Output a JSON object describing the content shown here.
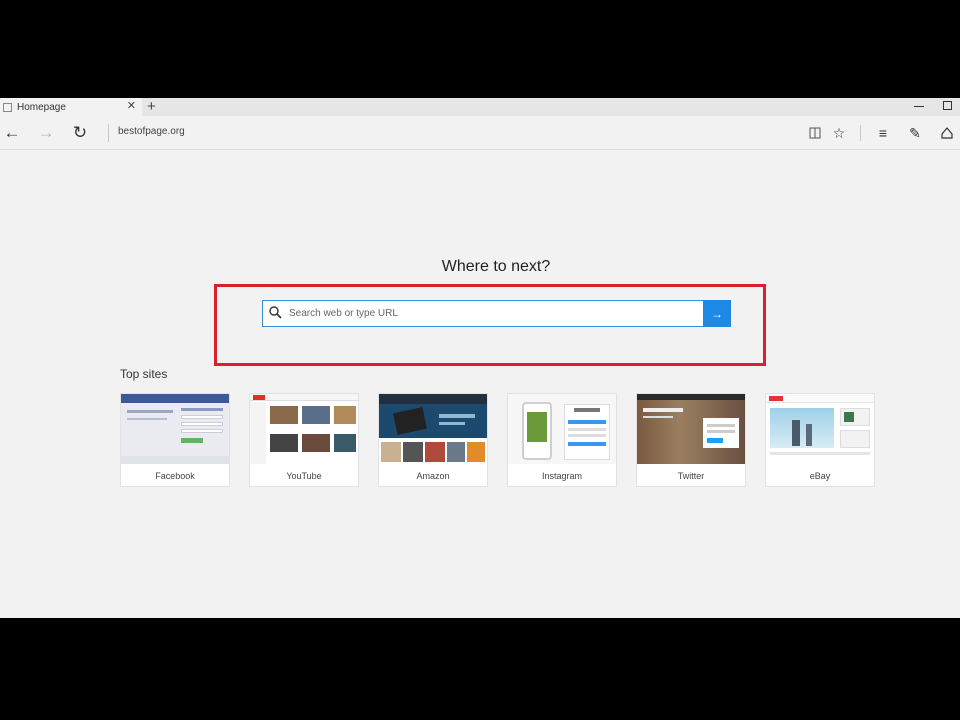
{
  "tab": {
    "title": "Homepage",
    "close": "✕",
    "new_tab": "+"
  },
  "nav": {
    "back_glyph": "←",
    "forward_glyph": "→",
    "refresh_glyph": "↻",
    "address": "bestofpage.org"
  },
  "toolbar": {
    "reading_view": "📖",
    "favorite": "☆",
    "hub": "≡",
    "notes": "✎",
    "share": "⇪"
  },
  "page": {
    "heading": "Where to next?",
    "search_placeholder": "Search web or type URL",
    "search_go": "→",
    "top_sites_label": "Top sites",
    "top_sites": [
      {
        "label": "Facebook"
      },
      {
        "label": "YouTube"
      },
      {
        "label": "Amazon"
      },
      {
        "label": "Instagram"
      },
      {
        "label": "Twitter"
      },
      {
        "label": "eBay"
      }
    ]
  },
  "colors": {
    "highlight": "#d9202c",
    "accent": "#1e88e5",
    "page_bg": "#f2f2f2"
  },
  "icons": [
    "page-icon",
    "close-icon",
    "plus-icon",
    "back-arrow-icon",
    "forward-arrow-icon",
    "refresh-icon",
    "reading-view-icon",
    "favorite-star-icon",
    "hub-icon",
    "notes-icon",
    "share-icon",
    "search-icon",
    "arrow-right-icon"
  ]
}
